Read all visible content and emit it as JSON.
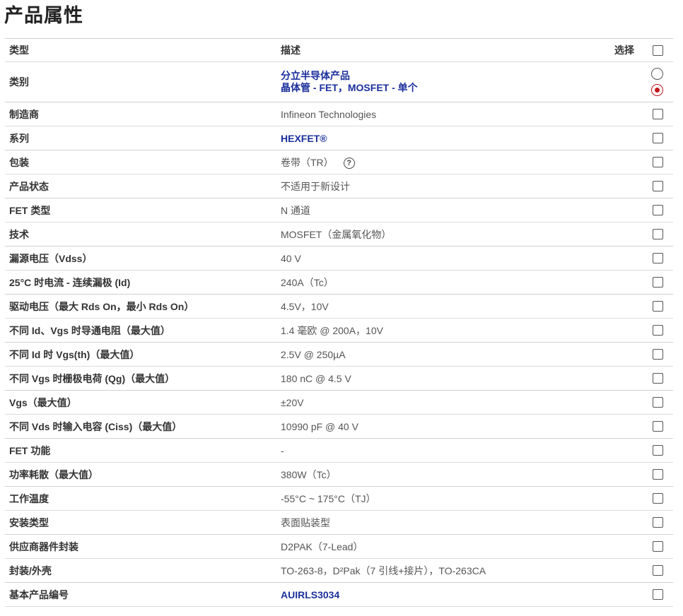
{
  "page_title": "产品属性",
  "header": {
    "type": "类型",
    "desc": "描述",
    "select": "选择"
  },
  "category": {
    "label": "类别",
    "line1": "分立半导体产品",
    "line2": "晶体管 - FET，MOSFET - 单个"
  },
  "rows": [
    {
      "label": "制造商",
      "value": "Infineon Technologies",
      "link": false
    },
    {
      "label": "系列",
      "value": "HEXFET®",
      "link": true
    },
    {
      "label": "包装",
      "value": "卷带（TR）",
      "link": false,
      "help": "?"
    },
    {
      "label": "产品状态",
      "value": "不适用于新设计",
      "link": false
    },
    {
      "label": "FET 类型",
      "value": "N 通道",
      "link": false
    },
    {
      "label": "技术",
      "value": "MOSFET（金属氧化物）",
      "link": false
    },
    {
      "label": "漏源电压（Vdss）",
      "value": "40 V",
      "link": false
    },
    {
      "label": "25°C 时电流 - 连续漏极 (Id)",
      "value": "240A（Tc）",
      "link": false
    },
    {
      "label": "驱动电压（最大 Rds On，最小 Rds On）",
      "value": "4.5V，10V",
      "link": false
    },
    {
      "label": "不同 Id、Vgs 时导通电阻（最大值）",
      "value": "1.4 毫欧 @ 200A，10V",
      "link": false
    },
    {
      "label": "不同 Id 时 Vgs(th)（最大值）",
      "value": "2.5V @ 250µA",
      "link": false
    },
    {
      "label": "不同 Vgs 时栅极电荷 (Qg)（最大值）",
      "value": "180 nC @ 4.5 V",
      "link": false
    },
    {
      "label": "Vgs（最大值）",
      "value": "±20V",
      "link": false
    },
    {
      "label": "不同 Vds 时输入电容 (Ciss)（最大值）",
      "value": "10990 pF @ 40 V",
      "link": false
    },
    {
      "label": "FET 功能",
      "value": "-",
      "link": false
    },
    {
      "label": "功率耗散（最大值）",
      "value": "380W（Tc）",
      "link": false
    },
    {
      "label": "工作温度",
      "value": "-55°C ~ 175°C（TJ）",
      "link": false
    },
    {
      "label": "安装类型",
      "value": "表面贴装型",
      "link": false
    },
    {
      "label": "供应商器件封装",
      "value": "D2PAK（7-Lead）",
      "link": false
    },
    {
      "label": "封装/外壳",
      "value": "TO-263-8，D²Pak（7 引线+接片），TO-263CA",
      "link": false
    },
    {
      "label": "基本产品编号",
      "value": "AUIRLS3034",
      "link": true
    }
  ]
}
